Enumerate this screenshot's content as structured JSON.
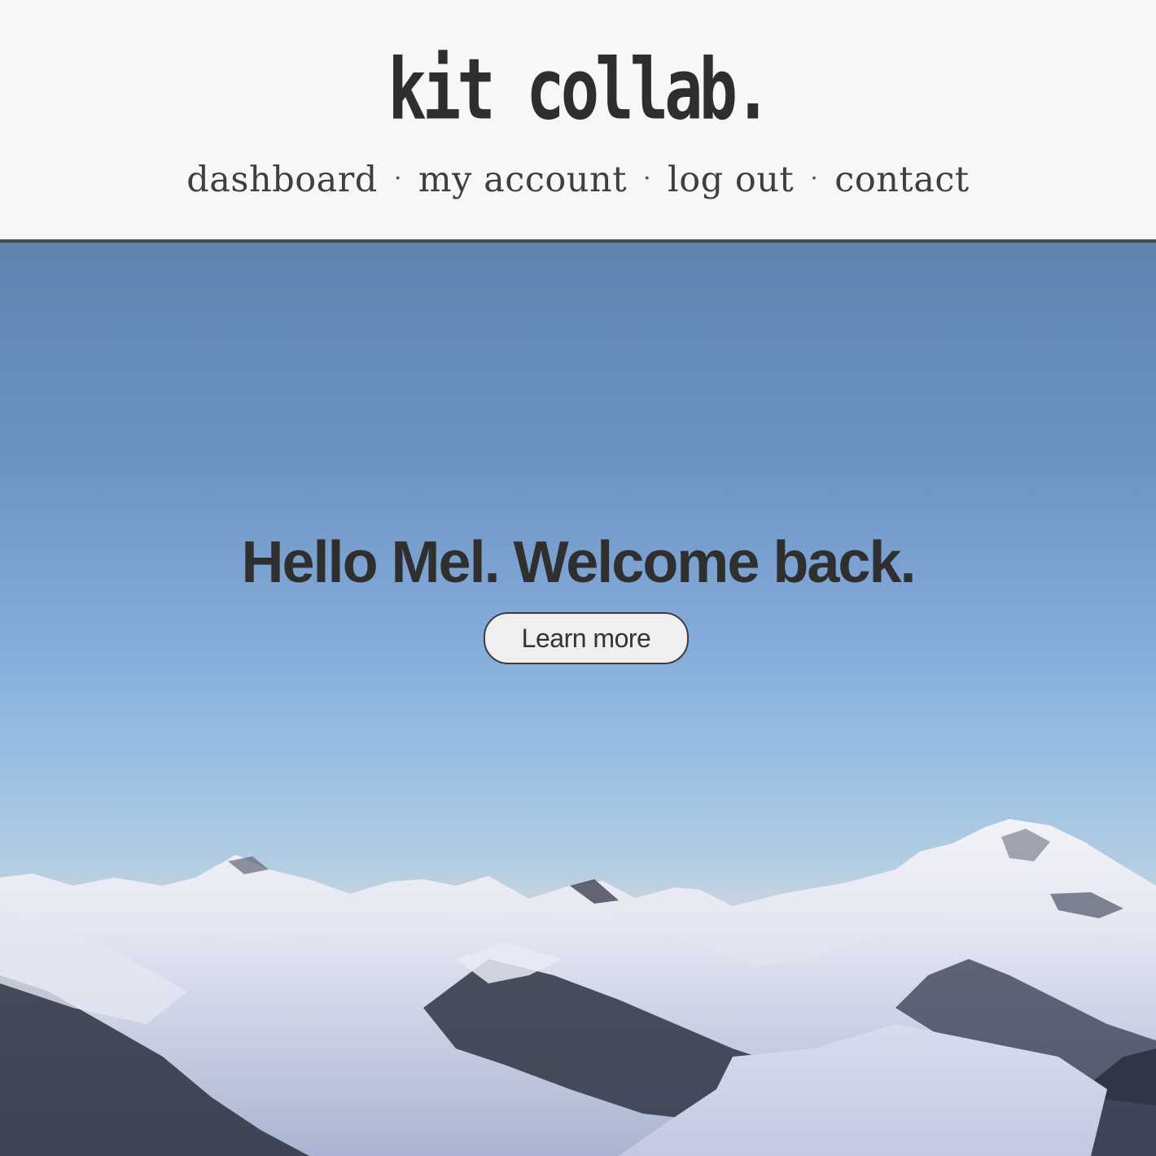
{
  "header": {
    "logo": "kit collab.",
    "nav": [
      {
        "label": "dashboard"
      },
      {
        "label": "my account"
      },
      {
        "label": "log out"
      },
      {
        "label": "contact"
      }
    ],
    "separator": "·"
  },
  "hero": {
    "headline": "Hello Mel. Welcome back.",
    "cta_label": "Learn more",
    "background_image": "snowy-mountain-range-at-dusk"
  },
  "colors": {
    "header_bg": "#f7f7f7",
    "text_dark": "#2f2f2f",
    "divider": "#45484d",
    "sky_top": "#5f84b0",
    "sky_horizon": "#c9b7c4",
    "snow": "#eef0f8"
  }
}
